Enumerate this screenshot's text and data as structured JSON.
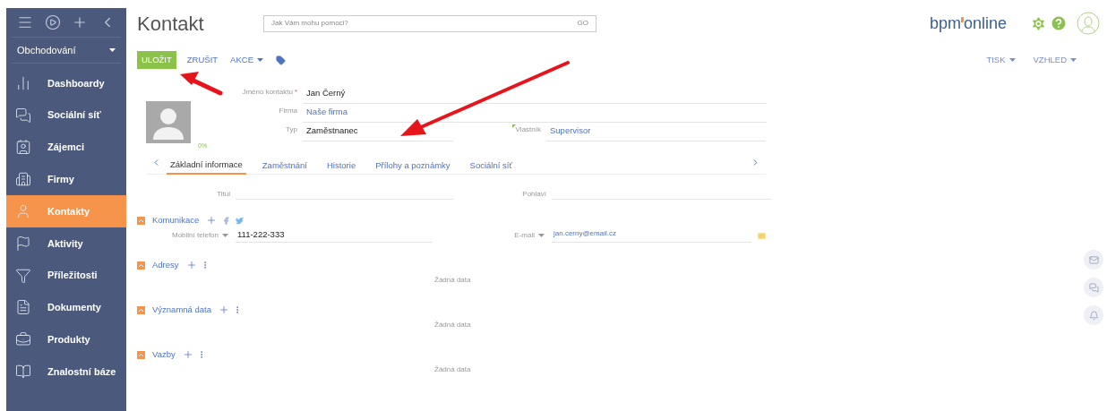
{
  "sidebar": {
    "workplace": "Obchodování",
    "items": [
      {
        "label": "Dashboardy",
        "selected": false
      },
      {
        "label": "Sociální síť",
        "selected": false
      },
      {
        "label": "Zájemci",
        "selected": false
      },
      {
        "label": "Firmy",
        "selected": false
      },
      {
        "label": "Kontakty",
        "selected": true
      },
      {
        "label": "Aktivity",
        "selected": false
      },
      {
        "label": "Příležitosti",
        "selected": false
      },
      {
        "label": "Dokumenty",
        "selected": false
      },
      {
        "label": "Produkty",
        "selected": false
      },
      {
        "label": "Znalostní báze",
        "selected": false
      }
    ]
  },
  "page_title": "Kontakt",
  "search": {
    "placeholder": "Jak Vám mohu pomoci?",
    "button": "GO"
  },
  "logo": {
    "left": "bpm",
    "right": "online"
  },
  "toolbar": {
    "primary": "ULOŽIT",
    "cancel": "ZRUŠIT",
    "actions": "AKCE",
    "right": [
      "TISK",
      "VZHLED"
    ]
  },
  "profile": {
    "completeness": "0%"
  },
  "header_fields": [
    {
      "label": "Jméno kontaktu",
      "required_mark": "*",
      "value": "Jan Černý",
      "link": false
    },
    {
      "label": "Firma",
      "value": "Naše firma",
      "link": true
    },
    {
      "label": "Typ",
      "value": "Zaměstnanec",
      "link": false
    }
  ],
  "owner": {
    "label": "Vlastník",
    "value": "Supervisor",
    "link": true
  },
  "tabs": [
    {
      "label": "Základní informace",
      "selected": true
    },
    {
      "label": "Zaměstnání",
      "selected": false
    },
    {
      "label": "Historie",
      "selected": false
    },
    {
      "label": "Přílohy a poznámky",
      "selected": false
    },
    {
      "label": "Sociální síť",
      "selected": false
    }
  ],
  "details": [
    {
      "label": "Titul"
    },
    {
      "label": "Pohlaví"
    }
  ],
  "sections": [
    {
      "kind": "communication",
      "title": "Komunikace",
      "rows": [
        {
          "label": "Mobilní telefon",
          "value": "111-222-333",
          "link": false
        },
        {
          "label": "E-mail",
          "value": "jan.cerny@email.cz",
          "link": true
        }
      ]
    },
    {
      "kind": "list",
      "title": "Adresy",
      "empty_text": "Žádná data"
    },
    {
      "kind": "list",
      "title": "Významná data",
      "empty_text": "Žádná data"
    },
    {
      "kind": "list",
      "title": "Vazby",
      "empty_text": "Žádná data"
    }
  ]
}
